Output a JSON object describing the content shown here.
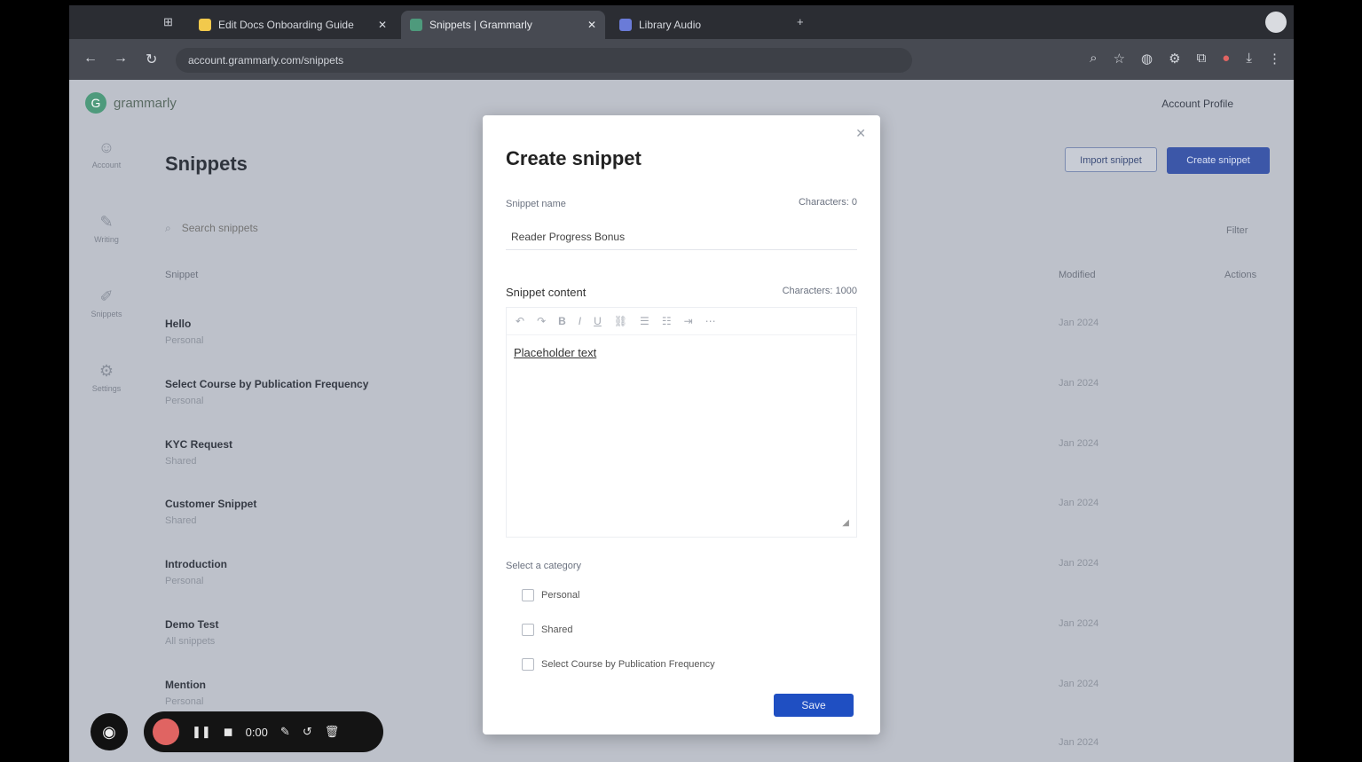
{
  "browser": {
    "tabs": [
      {
        "label": "Edit Docs Onboarding Guide",
        "active": false,
        "favicon_color": "#f2c94c"
      },
      {
        "label": "Snippets | Grammarly",
        "active": true,
        "favicon_color": "#4e9a7c"
      },
      {
        "label": "Library Audio",
        "active": false,
        "favicon_color": "#6a7bd8"
      }
    ],
    "url": "account.grammarly.com/snippets"
  },
  "app": {
    "logo_text": "grammarly",
    "account_label": "Account Profile",
    "page_title": "Snippets",
    "search_placeholder": "Search snippets",
    "sidenav": [
      {
        "label": "Account",
        "icon": "person-icon"
      },
      {
        "label": "Writing",
        "icon": "pen-icon"
      },
      {
        "label": "Snippets",
        "icon": "snippet-icon"
      },
      {
        "label": "Settings",
        "icon": "gear-icon"
      }
    ],
    "columns": {
      "name": "Snippet",
      "modified": "Modified",
      "actions": "Actions"
    },
    "filter_label": "Filter",
    "import_button": "Import snippet",
    "create_button": "Create snippet",
    "rows": [
      {
        "name": "Hello",
        "sub": "Personal",
        "date": "Jan 2024"
      },
      {
        "name": "Select Course by Publication Frequency",
        "sub": "Personal",
        "date": "Jan 2024"
      },
      {
        "name": "KYC Request",
        "sub": "Shared",
        "date": "Jan 2024"
      },
      {
        "name": "Customer Snippet",
        "sub": "Shared",
        "date": "Jan 2024"
      },
      {
        "name": "Introduction",
        "sub": "Personal",
        "date": "Jan 2024"
      },
      {
        "name": "Demo Test",
        "sub": "All snippets",
        "date": "Jan 2024"
      },
      {
        "name": "Mention",
        "sub": "Personal",
        "date": "Jan 2024"
      },
      {
        "name": "",
        "sub": "",
        "date": "Jan 2024"
      }
    ]
  },
  "modal": {
    "title": "Create snippet",
    "name_label": "Snippet name",
    "name_counter": "Characters: 0",
    "name_value": "Reader Progress Bonus",
    "content_label": "Snippet content",
    "content_counter": "Characters: 1000",
    "content_text": "Placeholder text",
    "toolbar": [
      "↶",
      "↷",
      "B",
      "I",
      "U",
      "⛓",
      "☰",
      "☷",
      "⇥",
      "⋯"
    ],
    "category_label": "Select a category",
    "categories": [
      "Personal",
      "Shared",
      "Select Course by Publication Frequency"
    ],
    "save_label": "Save"
  },
  "recorder": {
    "time": "0:00"
  }
}
